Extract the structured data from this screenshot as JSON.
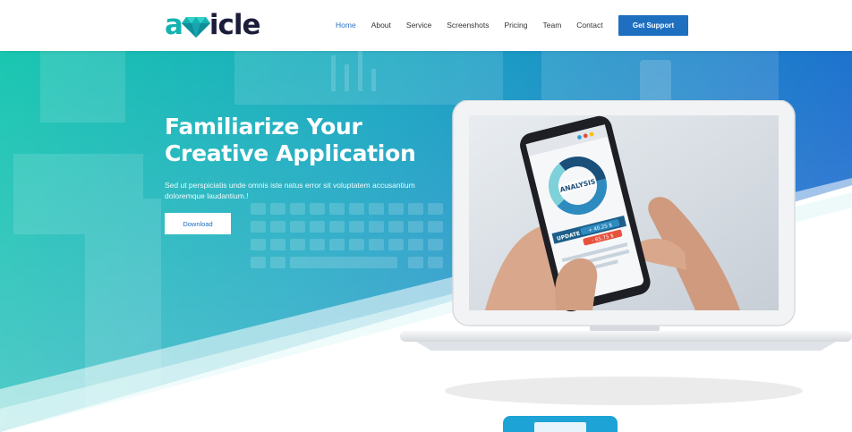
{
  "header": {
    "logo": {
      "prefix": "a",
      "suffix": "icle",
      "icon": "diamond-icon"
    },
    "nav": [
      {
        "label": "Home",
        "active": true
      },
      {
        "label": "About",
        "active": false
      },
      {
        "label": "Service",
        "active": false
      },
      {
        "label": "Screenshots",
        "active": false
      },
      {
        "label": "Pricing",
        "active": false
      },
      {
        "label": "Team",
        "active": false
      },
      {
        "label": "Contact",
        "active": false
      }
    ],
    "cta_label": "Get Support"
  },
  "hero": {
    "title_line1": "Familiarize Your",
    "title_line2": "Creative Application",
    "subtitle": "Sed ut perspiciatis unde omnis iste natus error sit voluptatem accusantium doloremque laudantium.!",
    "download_label": "Download"
  },
  "phone": {
    "chart_label": "ANALYSIS",
    "update_label": "UPDATE",
    "value_up": "+ 40.25 $",
    "value_down": "- 65.75 $"
  },
  "colors": {
    "brand_teal": "#15b3b0",
    "brand_dark": "#1b1d3a",
    "accent_blue": "#1e6fc0",
    "nav_active": "#2a73c5"
  }
}
